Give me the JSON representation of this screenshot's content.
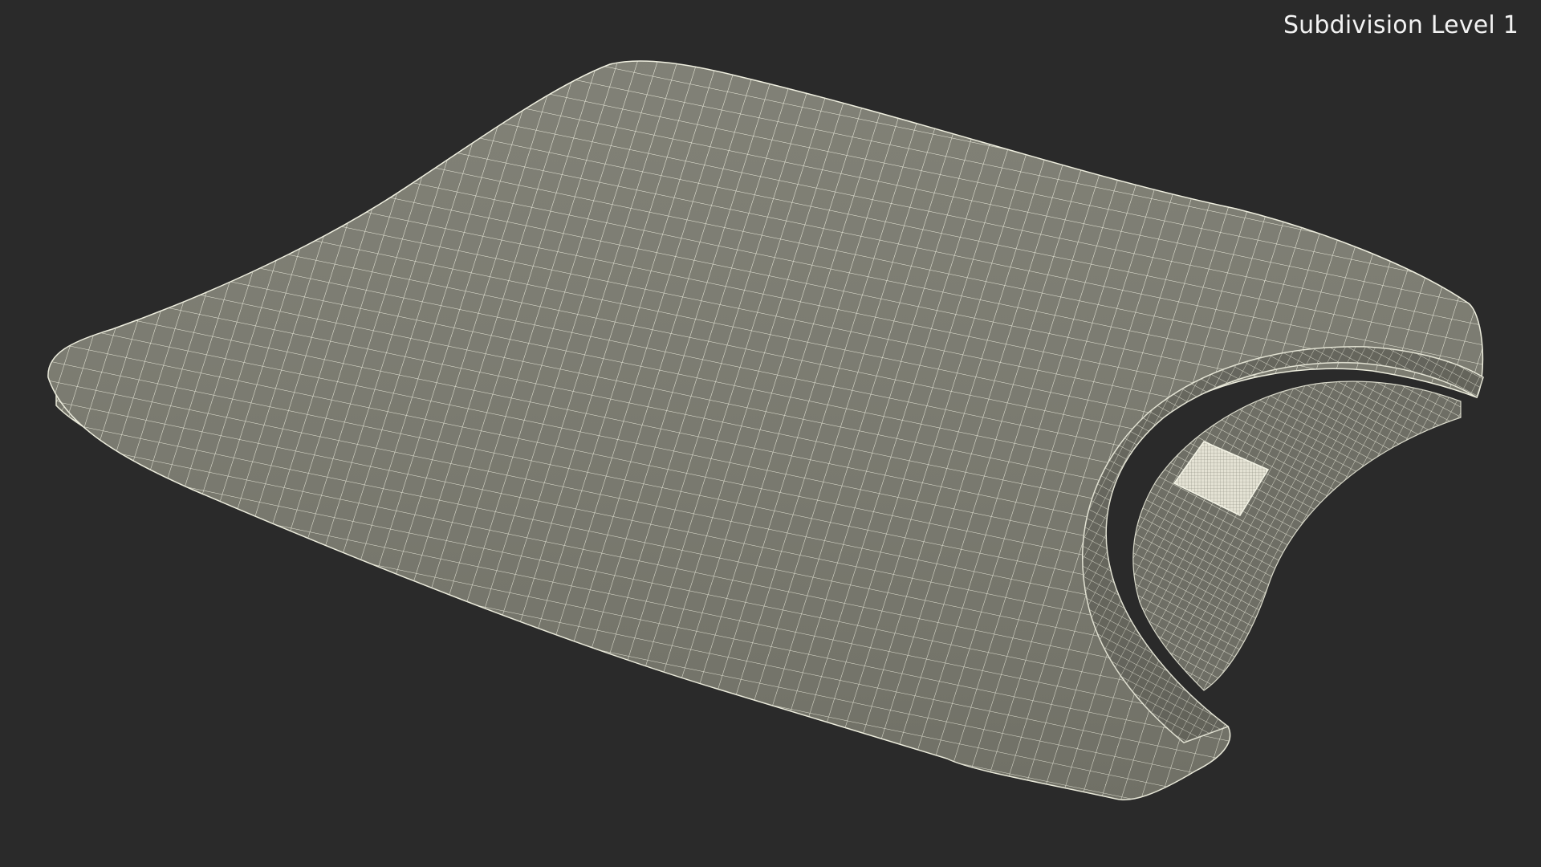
{
  "viewport": {
    "label": "Subdivision Level 1",
    "background_color": "#2a2a2a",
    "surface_color": "#7a7a6f",
    "wire_color": "#eeeede"
  }
}
